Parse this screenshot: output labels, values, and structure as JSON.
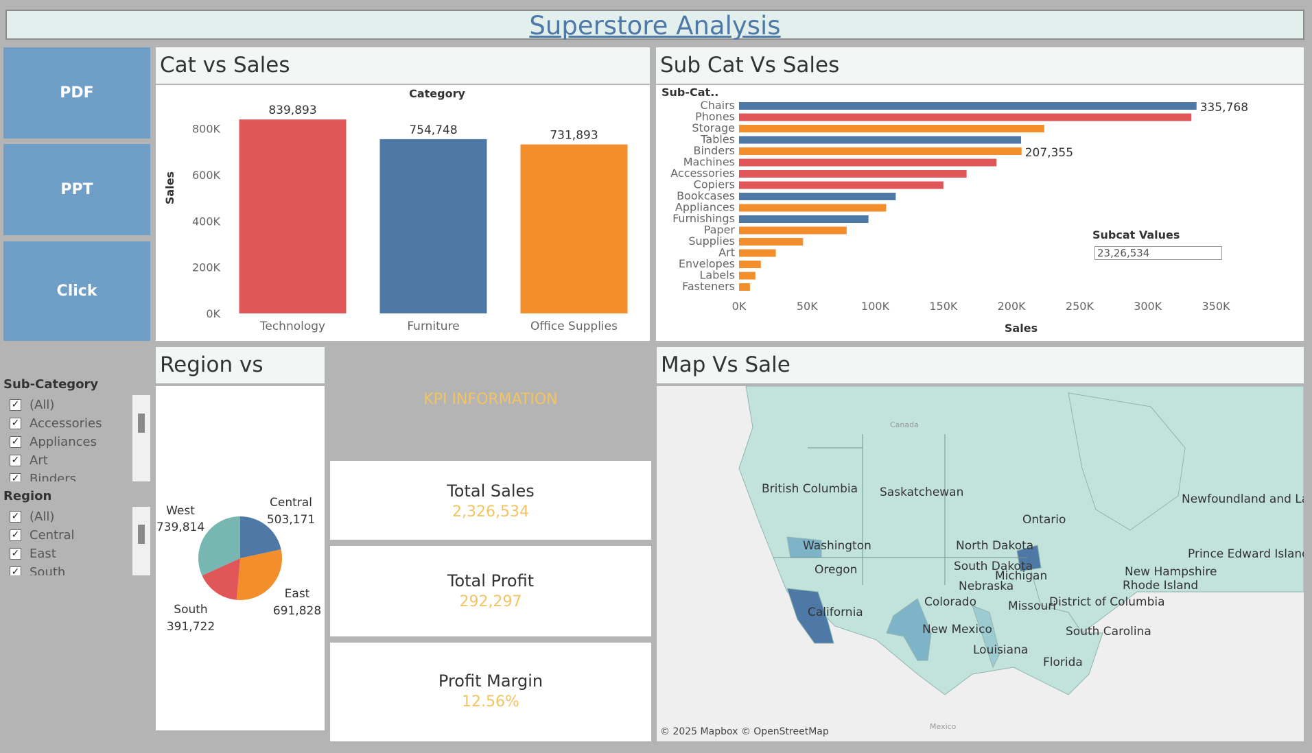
{
  "title": "Superstore Analysis",
  "buttons": {
    "pdf": "PDF",
    "ppt": "PPT",
    "click": "Click"
  },
  "panels": {
    "cat_sales": "Cat vs Sales",
    "subcat_sales": "Sub Cat Vs Sales",
    "region_sales": "Region vs Sales",
    "map_sale": "Map Vs Sale",
    "kpi_info": "KPI INFORMATION"
  },
  "kpis": [
    {
      "label": "Total Sales",
      "value": "2,326,534"
    },
    {
      "label": "Total Profit",
      "value": "292,297"
    },
    {
      "label": "Profit Margin",
      "value": "12.56%"
    }
  ],
  "filters": {
    "subcategory": {
      "title": "Sub-Category",
      "items": [
        "(All)",
        "Accessories",
        "Appliances",
        "Art",
        "Binders"
      ]
    },
    "region": {
      "title": "Region",
      "items": [
        "(All)",
        "Central",
        "East",
        "South"
      ]
    }
  },
  "subcat_values": {
    "label": "Subcat Values",
    "value": "23,26,534"
  },
  "map_attribution": "© 2025 Mapbox © OpenStreetMap",
  "map_labels": [
    "British Columbia",
    "Saskatchewan",
    "Newfoundland and Labrador",
    "Ontario",
    "Washington",
    "North Dakota",
    "Prince Edward Island",
    "Oregon",
    "South Dakota",
    "New Hampshire",
    "Michigan",
    "Nebraska",
    "Rhode Island",
    "Colorado",
    "District of Columbia",
    "Missouri",
    "California",
    "New Mexico",
    "South Carolina",
    "Louisiana",
    "Florida",
    "Mexico",
    "Canada"
  ],
  "colors": {
    "red": "#e15759",
    "blue": "#4e79a7",
    "orange": "#f28e2b",
    "teal": "#76b7b2",
    "gold": "#f2c462"
  },
  "chart_data": [
    {
      "type": "bar",
      "title": "Category",
      "ylabel": "Sales",
      "categories": [
        "Technology",
        "Furniture",
        "Office Supplies"
      ],
      "values": [
        839893,
        754748,
        731893
      ],
      "value_labels": [
        "839,893",
        "754,748",
        "731,893"
      ],
      "colors": [
        "#e15759",
        "#4e79a7",
        "#f28e2b"
      ],
      "yticks": [
        "0K",
        "200K",
        "400K",
        "600K",
        "800K"
      ],
      "ylim": [
        0,
        900000
      ]
    },
    {
      "type": "bar",
      "orientation": "horizontal",
      "title": "Sub-Cat..",
      "xlabel": "Sales",
      "categories": [
        "Chairs",
        "Phones",
        "Storage",
        "Tables",
        "Binders",
        "Machines",
        "Accessories",
        "Copiers",
        "Bookcases",
        "Appliances",
        "Furnishings",
        "Paper",
        "Supplies",
        "Art",
        "Envelopes",
        "Labels",
        "Fasteners"
      ],
      "values": [
        335768,
        332000,
        224000,
        207000,
        207355,
        189000,
        167000,
        150000,
        115000,
        108000,
        95000,
        79000,
        47000,
        27000,
        16000,
        12000,
        8000
      ],
      "value_labels": {
        "0": "335,768",
        "4": "207,355"
      },
      "colors": [
        "#4e79a7",
        "#e15759",
        "#f28e2b",
        "#4e79a7",
        "#f28e2b",
        "#e15759",
        "#e15759",
        "#e15759",
        "#4e79a7",
        "#f28e2b",
        "#4e79a7",
        "#f28e2b",
        "#f28e2b",
        "#f28e2b",
        "#f28e2b",
        "#f28e2b",
        "#f28e2b"
      ],
      "xticks": [
        "0K",
        "50K",
        "100K",
        "150K",
        "200K",
        "250K",
        "300K",
        "350K"
      ],
      "xlim": [
        0,
        370000
      ]
    },
    {
      "type": "pie",
      "categories": [
        "Central",
        "East",
        "South",
        "West"
      ],
      "values": [
        503171,
        691828,
        391722,
        739814
      ],
      "value_labels": [
        "503,171",
        "691,828",
        "391,722",
        "739,814"
      ],
      "colors": [
        "#4e79a7",
        "#f28e2b",
        "#e15759",
        "#76b7b2"
      ]
    }
  ]
}
